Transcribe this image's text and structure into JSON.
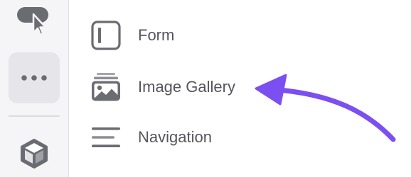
{
  "sidebar": {
    "icons": [
      "cursor-icon",
      "more-icon",
      "cube-icon"
    ]
  },
  "menu": {
    "items": [
      {
        "label": "Form",
        "icon": "form-icon"
      },
      {
        "label": "Image Gallery",
        "icon": "image-gallery-icon"
      },
      {
        "label": "Navigation",
        "icon": "navigation-icon"
      }
    ]
  },
  "colors": {
    "sidebar_bg": "#f5f5f7",
    "active_button_bg": "#e6e6ea",
    "text": "#55555f",
    "icon": "#6b6b72",
    "arrow": "#7b4ff0"
  }
}
